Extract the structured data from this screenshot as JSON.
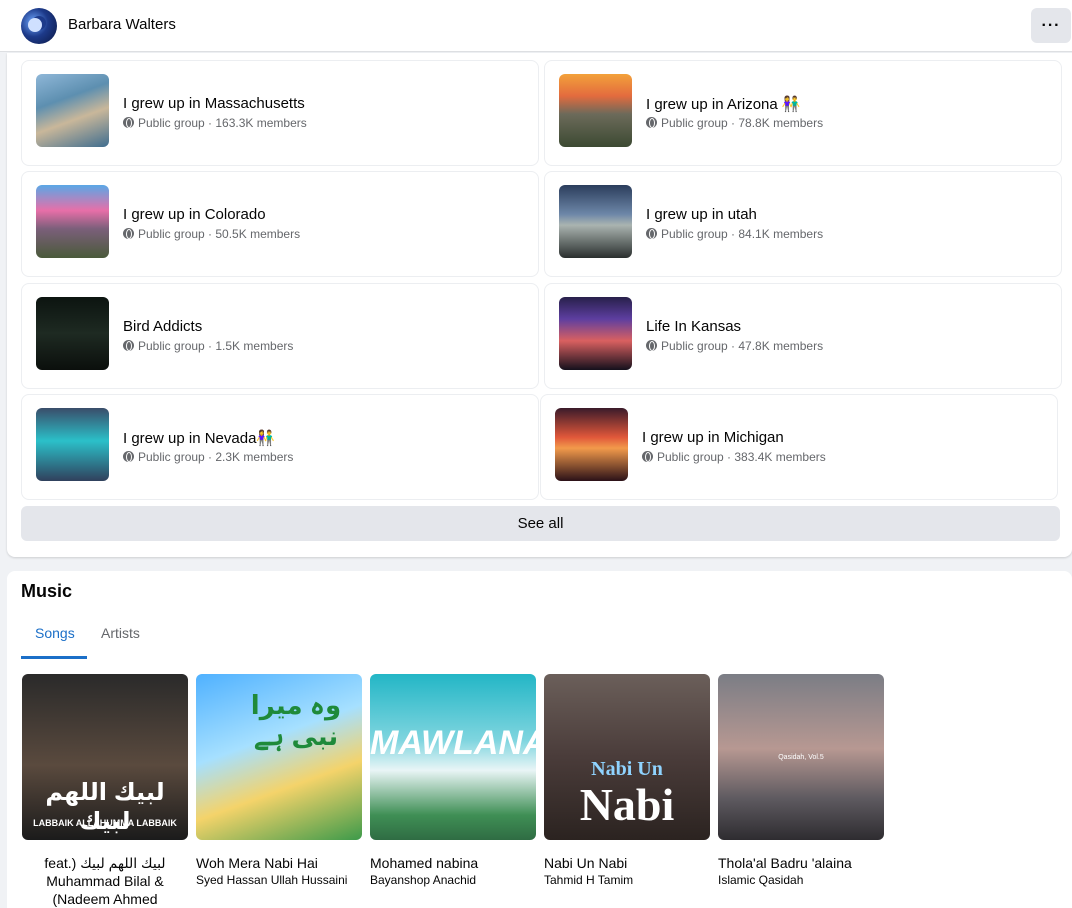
{
  "header": {
    "name": "Barbara Walters",
    "more_label": "···"
  },
  "groups": [
    {
      "name": "I grew up in Massachusetts",
      "meta": "Public group · 163.3K members",
      "thumb": "linear-gradient(160deg,#8fb7d8 0%,#5d8fb0 35%,#c9b79a 60%,#3f6d8f 100%)"
    },
    {
      "name": "I grew up in Arizona 👫",
      "meta": "Public group · 78.8K members",
      "thumb": "linear-gradient(180deg,#f3a13a 0%,#e36b3e 30%,#6c6a5a 55%,#3c4a32 100%)"
    },
    {
      "name": "I grew up in Colorado",
      "meta": "Public group · 50.5K members",
      "thumb": "linear-gradient(180deg,#5aa7e6 0%,#e76fa8 35%,#7b5f7a 60%,#4a5a3a 100%)"
    },
    {
      "name": "I grew up in utah",
      "meta": "Public group · 84.1K members",
      "thumb": "linear-gradient(180deg,#2b3d5c 0%,#6d87a8 40%,#aab4b0 55%,#2a2f2e 100%)"
    },
    {
      "name": "Bird Addicts",
      "meta": "Public group · 1.5K members",
      "thumb": "linear-gradient(180deg,#0c1410 0%,#1e2a22 50%,#0b0f0c 100%)"
    },
    {
      "name": "Life In Kansas",
      "meta": "Public group · 47.8K members",
      "thumb": "linear-gradient(180deg,#28204a 0%,#5d3ea0 30%,#d96060 60%,#14101c 100%)"
    },
    {
      "name": "I grew up in Nevada👫",
      "meta": "Public group · 2.3K members",
      "thumb": "linear-gradient(180deg,#3a4d6a 0%,#2bc0c9 45%,#30405c 100%)"
    },
    {
      "name": "I grew up in Michigan",
      "meta": "Public group · 383.4K members",
      "thumb": "linear-gradient(180deg,#3a1b2a 0%,#e0573a 40%,#f29a4b 55%,#2b1118 100%)"
    }
  ],
  "see_all_label": "See all",
  "music": {
    "title": "Music",
    "tabs": [
      {
        "label": "Songs"
      },
      {
        "label": "Artists"
      }
    ],
    "songs": [
      {
        "title": "feat.) لبيك اللهم لبيك Muhammad Bilal & (Nadeem Ahmed",
        "artist": "",
        "cover_text": "لبيك اللهم لبيك",
        "cover_sub": "LABBAIK ALLAHUMMA LABBAIK",
        "cover": "linear-gradient(180deg,#2a2a2a 0%,#5a4a3e 55%,#1b1b1b 100%)"
      },
      {
        "title": "Woh Mera Nabi Hai",
        "artist": "Syed Hassan Ullah Hussaini",
        "cover_text": "وہ میرا نبی ہے",
        "cover_sub": "",
        "cover": "linear-gradient(160deg,#4fb1ff 0%,#a6e0ff 40%,#f4d36a 65%,#3d9a4a 100%)"
      },
      {
        "title": "Mohamed nabina",
        "artist": "Bayanshop Anachid",
        "cover_text": "MAWLANA",
        "cover_sub": "",
        "cover": "linear-gradient(180deg,#23b6c6 0%,#7fd5df 40%,#e9f5f6 58%,#3f8f55 85%,#2f6c43 100%)"
      },
      {
        "title": "Nabi Un Nabi",
        "artist": "Tahmid H Tamim",
        "cover_text": "Nabi",
        "cover_sub": "Nabi Un",
        "cover": "linear-gradient(180deg,#6b5f5a 0%,#4a3c3a 50%,#2b2320 100%)"
      },
      {
        "title": "Thola'al Badru 'alaina",
        "artist": "Islamic Qasidah",
        "cover_text": "Qasidah, Vol.5",
        "cover_sub": "",
        "cover": "linear-gradient(180deg,#7b7d85 0%,#b79892 45%,#5e5a60 75%,#2e2c30 100%)"
      }
    ]
  }
}
